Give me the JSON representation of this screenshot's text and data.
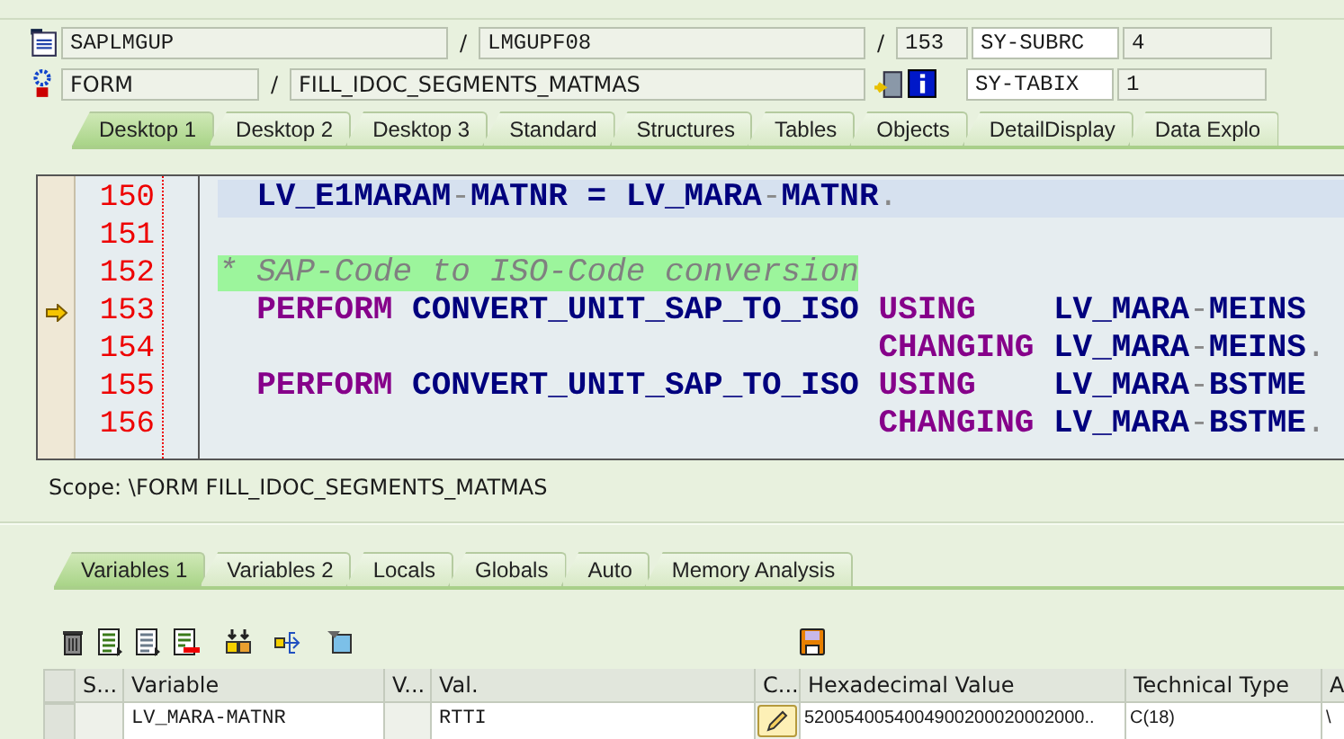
{
  "position": {
    "program": "SAPLMGUP",
    "sep1": "/",
    "include": "LMGUPF08",
    "sep2": "/",
    "line": "153"
  },
  "event": {
    "type": "FORM",
    "sep": "/",
    "name": "FILL_IDOC_SEGMENTS_MATMAS"
  },
  "system_fields": [
    {
      "name": "SY-SUBRC",
      "value": "4"
    },
    {
      "name": "SY-TABIX",
      "value": "1"
    }
  ],
  "desktop_tabs": [
    {
      "label": "Desktop 1",
      "selected": true
    },
    {
      "label": "Desktop 2",
      "selected": false
    },
    {
      "label": "Desktop 3",
      "selected": false
    },
    {
      "label": "Standard",
      "selected": false
    },
    {
      "label": "Structures",
      "selected": false
    },
    {
      "label": "Tables",
      "selected": false
    },
    {
      "label": "Objects",
      "selected": false
    },
    {
      "label": "DetailDisplay",
      "selected": false
    },
    {
      "label": "Data Explo",
      "selected": false
    }
  ],
  "code_lines": [
    {
      "number": "150",
      "current": true,
      "execution_arrow": false,
      "tokens": [
        {
          "text": "  LV_E1MARAM",
          "kind": "id"
        },
        {
          "text": "-",
          "kind": "op"
        },
        {
          "text": "MATNR = LV_MARA",
          "kind": "id"
        },
        {
          "text": "-",
          "kind": "op"
        },
        {
          "text": "MATNR",
          "kind": "id"
        },
        {
          "text": ".",
          "kind": "op"
        }
      ]
    },
    {
      "number": "151",
      "current": false,
      "execution_arrow": false
    },
    {
      "number": "152",
      "current": false,
      "execution_arrow": false,
      "tokens": [
        {
          "text": "* SAP-Code to ISO-Code conversion",
          "kind": "comment"
        }
      ]
    },
    {
      "number": "153",
      "current": false,
      "execution_arrow": true,
      "tokens": [
        {
          "text": "  PERFORM",
          "kind": "kw"
        },
        {
          "text": " CONVERT_UNIT_SAP_TO_ISO ",
          "kind": "id"
        },
        {
          "text": "USING    ",
          "kind": "kw"
        },
        {
          "text": "LV_MARA",
          "kind": "id"
        },
        {
          "text": "-",
          "kind": "op"
        },
        {
          "text": "MEINS",
          "kind": "id"
        }
      ]
    },
    {
      "number": "154",
      "current": false,
      "execution_arrow": false,
      "tokens": [
        {
          "text": "                                  CHANGING ",
          "kind": "kw"
        },
        {
          "text": "LV_MARA",
          "kind": "id"
        },
        {
          "text": "-",
          "kind": "op"
        },
        {
          "text": "MEINS",
          "kind": "id"
        },
        {
          "text": ".",
          "kind": "op"
        }
      ]
    },
    {
      "number": "155",
      "current": false,
      "execution_arrow": false,
      "tokens": [
        {
          "text": "  PERFORM",
          "kind": "kw"
        },
        {
          "text": " CONVERT_UNIT_SAP_TO_ISO ",
          "kind": "id"
        },
        {
          "text": "USING    ",
          "kind": "kw"
        },
        {
          "text": "LV_MARA",
          "kind": "id"
        },
        {
          "text": "-",
          "kind": "op"
        },
        {
          "text": "BSTME",
          "kind": "id"
        }
      ]
    },
    {
      "number": "156",
      "current": false,
      "execution_arrow": false,
      "tokens": [
        {
          "text": "                                  CHANGING ",
          "kind": "kw"
        },
        {
          "text": "LV_MARA",
          "kind": "id"
        },
        {
          "text": "-",
          "kind": "op"
        },
        {
          "text": "BSTME",
          "kind": "id"
        },
        {
          "text": ".",
          "kind": "op"
        }
      ]
    }
  ],
  "scope": "Scope: \\FORM FILL_IDOC_SEGMENTS_MATMAS",
  "variable_tabs": [
    {
      "label": "Variables 1",
      "selected": true
    },
    {
      "label": "Variables 2",
      "selected": false
    },
    {
      "label": "Locals",
      "selected": false
    },
    {
      "label": "Globals",
      "selected": false
    },
    {
      "label": "Auto",
      "selected": false
    },
    {
      "label": "Memory Analysis",
      "selected": false
    }
  ],
  "table": {
    "columns": [
      "S...",
      "Variable",
      "V...",
      "Val.",
      "C...",
      "Hexadecimal Value",
      "Technical Type",
      "A"
    ],
    "rows": [
      {
        "cells": [
          "",
          "LV_MARA-MATNR",
          "",
          "RTTI",
          "",
          "5200540054004900200020002000..",
          "C(18)",
          "\\"
        ]
      }
    ]
  }
}
